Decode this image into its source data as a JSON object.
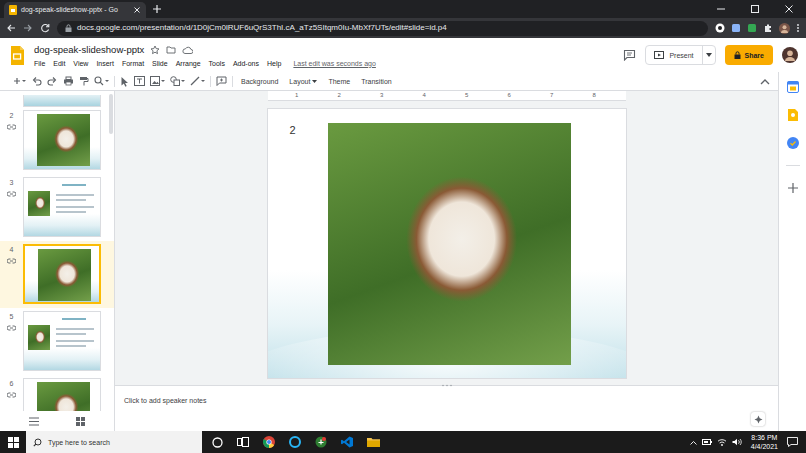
{
  "browser": {
    "tab_title": "dog-speak-slideshow-pptx - Go",
    "url": "docs.google.com/presentation/d/1D0jCm0lRUF6uQrS3ThI.cA_aTz5SItqm0Iu-MbXf7UTs/edit#slide=id.p4"
  },
  "document": {
    "title": "dog-speak-slideshow-pptx"
  },
  "menu": [
    "File",
    "Edit",
    "View",
    "Insert",
    "Format",
    "Slide",
    "Arrange",
    "Tools",
    "Add-ons",
    "Help"
  ],
  "last_edit": "Last edit was seconds ago",
  "buttons": {
    "present": "Present",
    "share": "Share"
  },
  "toolbar": [
    {
      "label": "Background",
      "kind": "button"
    },
    {
      "label": "Layout",
      "kind": "dropdown"
    },
    {
      "label": "Theme",
      "kind": "button"
    },
    {
      "label": "Transition",
      "kind": "button"
    }
  ],
  "filmstrip": [
    {
      "number": "2",
      "selected": false,
      "kind": "photo"
    },
    {
      "number": "3",
      "selected": false,
      "kind": "photo-text"
    },
    {
      "number": "4",
      "selected": true,
      "kind": "photo"
    },
    {
      "number": "5",
      "selected": false,
      "kind": "photo-text"
    },
    {
      "number": "6",
      "selected": false,
      "kind": "photo"
    }
  ],
  "ruler": [
    "1",
    "2",
    "3",
    "4",
    "5",
    "6",
    "7",
    "8"
  ],
  "slide": {
    "number": "2"
  },
  "notes": {
    "placeholder": "Click to add speaker notes"
  },
  "taskbar": {
    "search_placeholder": "Type here to search",
    "time": "8:36 PM",
    "date": "4/4/2021"
  }
}
